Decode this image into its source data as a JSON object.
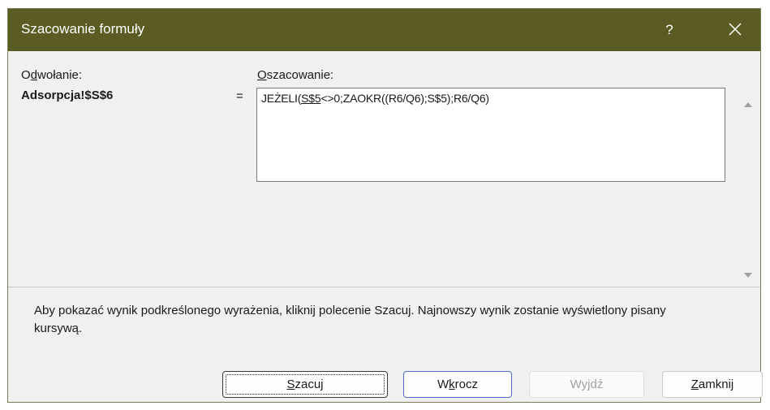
{
  "dialog": {
    "title": "Szacowanie formuły",
    "help_label": "?",
    "reference": {
      "label_prefix": "O",
      "label_accel": "d",
      "label_suffix": "wołanie:",
      "value": "Adsorpcja!$S$6"
    },
    "evaluation": {
      "label_accel": "O",
      "label_suffix": "szacowanie:",
      "equals": "=",
      "formula_prefix": "JEŻELI(",
      "formula_underlined": "S$5",
      "formula_suffix": "<>0;ZAOKR((R6/Q6);S$5);R6/Q6)"
    },
    "info_text": "Aby pokazać wynik podkreślonego wyrażenia, kliknij polecenie Szacuj. Najnowszy wynik zostanie wyświetlony pisany kursywą.",
    "buttons": {
      "szacuj": {
        "accel": "S",
        "rest": "zacuj"
      },
      "wkrocz": {
        "pre": "W",
        "accel": "k",
        "rest": "rocz"
      },
      "wyjdz": {
        "label": "Wyjdź"
      },
      "zamknij": {
        "accel": "Z",
        "rest": "amknij"
      }
    },
    "colors": {
      "titlebar": "#5a5c23",
      "dialog_bg": "#f0f0f0",
      "primary_border": "#4d6cc7"
    }
  }
}
